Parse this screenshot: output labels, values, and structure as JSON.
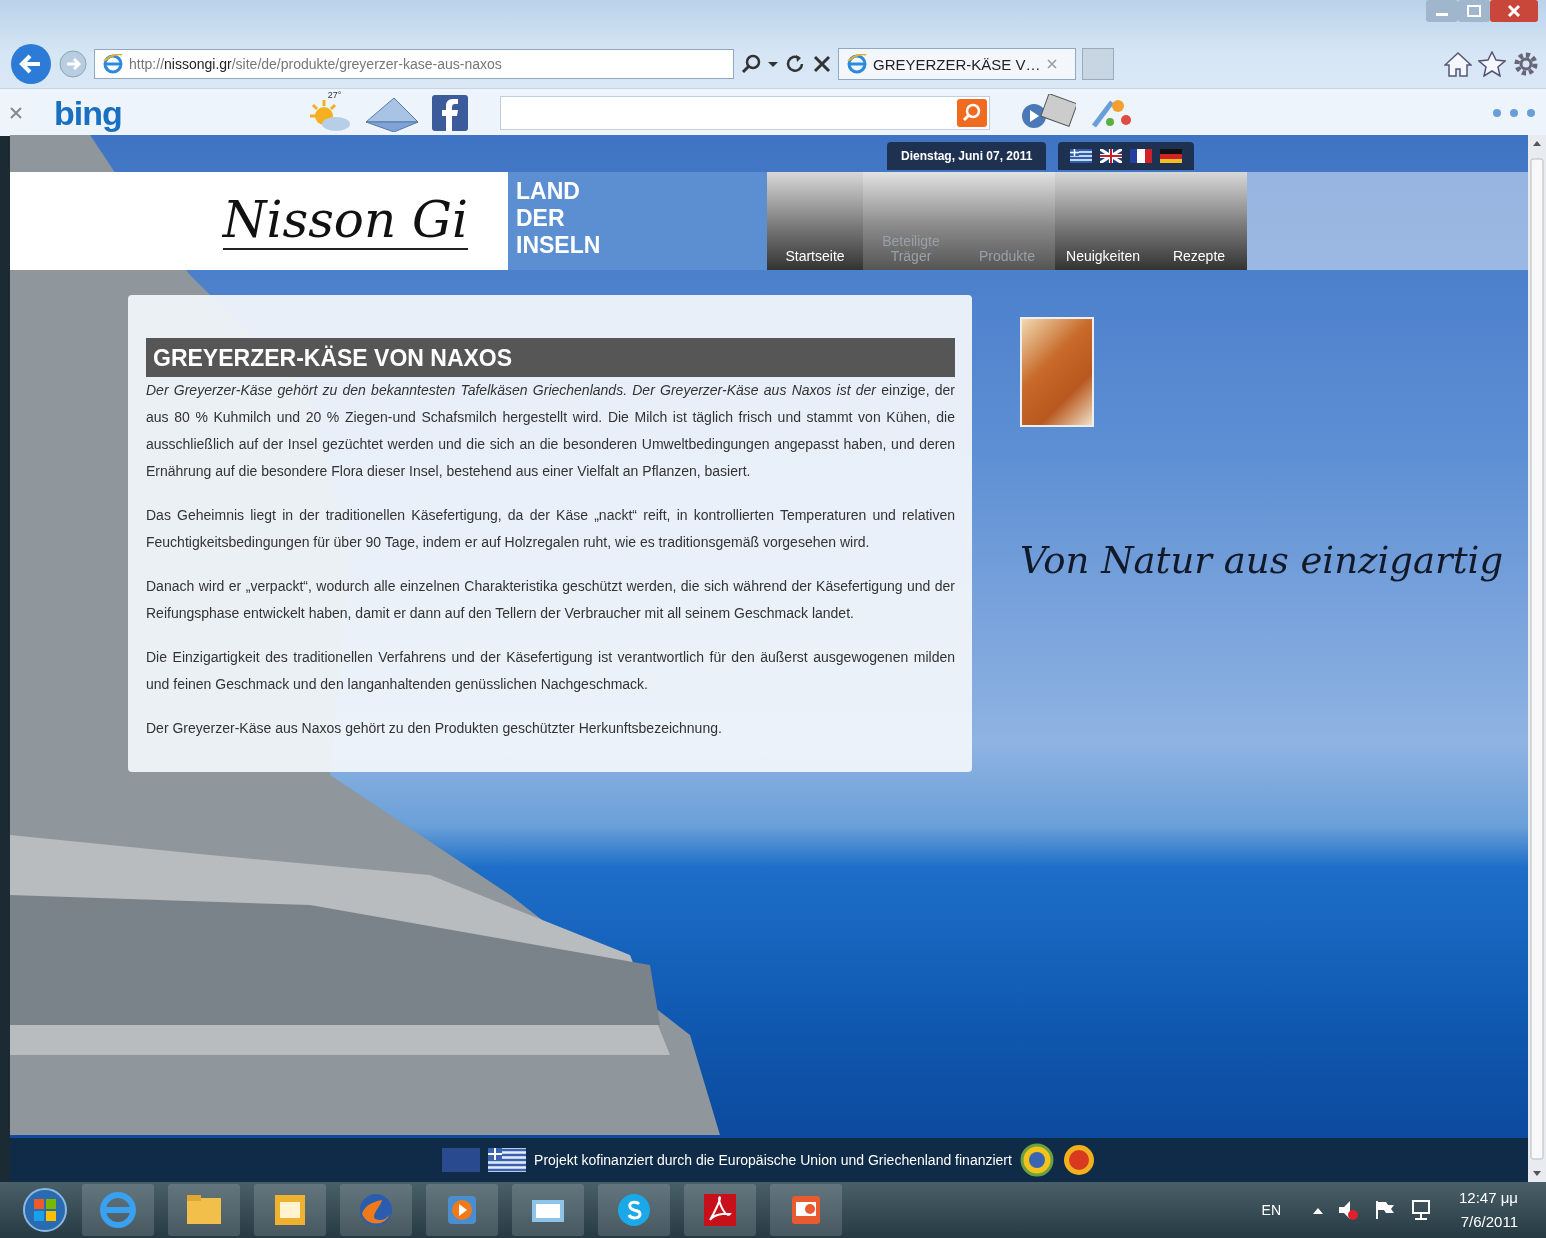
{
  "browser": {
    "url": "http://**nissongi.gr**/site/de/produkte/greyerzer-kase-aus-naxos",
    "tab_title": "GREYERZER-KÄSE V…"
  },
  "toolbar": {
    "logo": "bing",
    "temperature": "27°"
  },
  "site": {
    "date": "Dienstag, Juni 07, 2011",
    "logo": "Nisson Gi",
    "tagline": [
      "LAND",
      "DER",
      "INSELN"
    ],
    "nav": [
      {
        "label": "Startseite",
        "dimmed": false
      },
      {
        "label": "Beteiligte Träger",
        "dimmed": true
      },
      {
        "label": "Produkte",
        "dimmed": true
      },
      {
        "label": "Neuigkeiten",
        "dimmed": false
      },
      {
        "label": "Rezepte",
        "dimmed": false
      }
    ],
    "slogan": "Von Natur aus einzigartig"
  },
  "article": {
    "title": "GREYERZER-KÄSE VON NAXOS",
    "paragraphs": [
      "*Der Greyerzer-Käse gehört zu den bekanntesten Tafelkäsen Griechenlands. Der Greyerzer-Käse aus Naxos ist der* einzige, der aus 80 % Kuhmilch und 20 % Ziegen-und Schafsmilch hergestellt wird. Die Milch ist täglich frisch und stammt von Kühen, die ausschließlich auf der Insel gezüchtet werden und die sich an die besonderen Umweltbedingungen angepasst haben, und deren Ernährung auf die besondere Flora dieser Insel, bestehend aus einer Vielfalt an Pflanzen, basiert.",
      "Das Geheimnis liegt in der traditionellen Käsefertigung, da der Käse „nackt“ reift, in kontrollierten Temperaturen und relativen Feuchtigkeitsbedingungen für über 90 Tage, indem er auf Holzregalen ruht, wie es traditionsgemäß vorgesehen wird.",
      "Danach wird er „verpackt“, wodurch alle einzelnen Charakteristika geschützt werden, die sich während der Käsefertigung und der Reifungsphase entwickelt haben, damit er dann auf den Tellern der Verbraucher mit all seinem Geschmack landet.",
      "Die Einzigartigkeit des traditionellen Verfahrens und der Käsefertigung ist verantwortlich für den äußerst ausgewogenen milden und feinen Geschmack und den langanhaltenden genüsslichen Nachgeschmack.",
      "Der Greyerzer-Käse aus Naxos gehört zu den Produkten geschützter Herkunftsbezeichnung."
    ]
  },
  "footer": {
    "text": "Projekt kofinanziert durch die Europäische Union und Griechenland finanziert"
  },
  "taskbar": {
    "language": "EN",
    "time": "12:47 μμ",
    "date": "7/6/2011"
  }
}
